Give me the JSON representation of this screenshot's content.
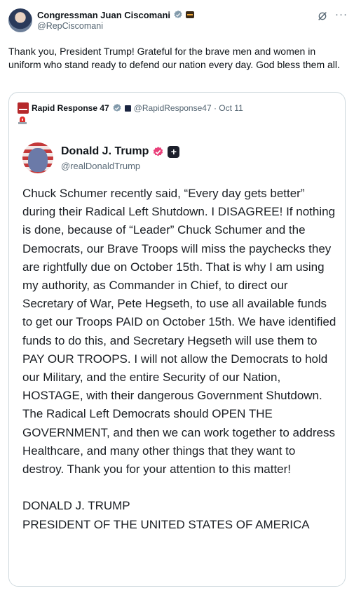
{
  "author": {
    "display_name": "Congressman Juan Ciscomani",
    "handle": "@RepCiscomani"
  },
  "tweet_text": "Thank you, President Trump! Grateful for the brave men and women in uniform who stand ready to defend our nation every day. God bless them all.",
  "more_label": "···",
  "quote": {
    "display_name": "Rapid Response 47",
    "handle_and_date": "@RapidResponse47 · Oct 11",
    "post": {
      "display_name": "Donald J. Trump",
      "handle": "@realDonaldTrump",
      "plus_label": "+",
      "body": "Chuck Schumer recently said, “Every day gets better” during their Radical Left Shutdown. I DISAGREE! If nothing is done, because of “Leader” Chuck Schumer and the Democrats, our Brave Troops will miss the paychecks they are rightfully due on October 15th. That is why I am using my authority, as Commander in Chief, to direct our Secretary of War, Pete Hegseth, to use all available funds to get our Troops PAID on October 15th. We have identified funds to do this, and Secretary Hegseth will use them to PAY OUR TROOPS. I will not allow the Democrats to hold our Military, and the entire Security of our Nation, HOSTAGE, with their dangerous Government Shutdown. The Radical Left Democrats should OPEN THE GOVERNMENT, and then we can work together to address Healthcare, and many other things that they want to destroy. Thank you for your attention to this matter!\n\nDONALD J. TRUMP\nPRESIDENT OF THE UNITED STATES OF AMERICA"
    }
  },
  "colors": {
    "verified_blue": "#1d9bf0",
    "pink_badge": "#e9407a",
    "secondary_text": "#536471",
    "card_border": "#cfd9de"
  },
  "icons": {
    "verified": "verified-badge-icon",
    "grok": "grok-icon",
    "more": "more-icon",
    "siren": "siren-icon"
  }
}
